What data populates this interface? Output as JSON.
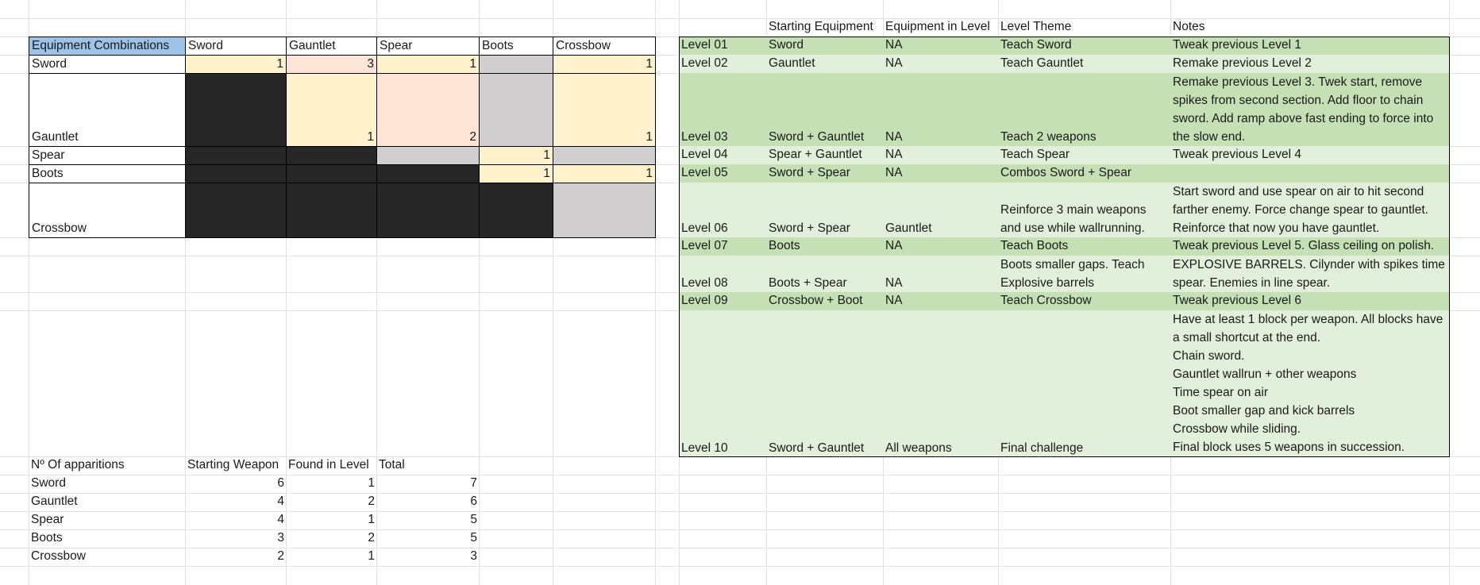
{
  "matrix": {
    "corner": "Equipment Combinations",
    "cols": [
      "Sword",
      "Gauntlet",
      "Spear",
      "Boots",
      "Crossbow"
    ],
    "rows": [
      "Sword",
      "Gauntlet",
      "Spear",
      "Boots",
      "Crossbow"
    ],
    "values": {
      "sword": {
        "sword": "1",
        "gauntlet": "3",
        "spear": "1",
        "crossbow": "1"
      },
      "gauntlet": {
        "gauntlet": "1",
        "spear": "2",
        "crossbow": "1"
      },
      "spear": {
        "boots": "1"
      },
      "boots": {
        "boots": "1",
        "crossbow": "1"
      }
    }
  },
  "levels": {
    "headers": {
      "starting": "Starting Equipment",
      "in_level": "Equipment in Level",
      "theme": "Level Theme",
      "notes": "Notes"
    },
    "rows": [
      {
        "level": "Level 01",
        "starting": "Sword",
        "in_level": "NA",
        "theme": "Teach Sword",
        "notes": "Tweak previous Level 1"
      },
      {
        "level": "Level 02",
        "starting": "Gauntlet",
        "in_level": "NA",
        "theme": "Teach Gauntlet",
        "notes": "Remake previous Level 2"
      },
      {
        "level": "Level 03",
        "starting": "Sword + Gauntlet",
        "in_level": "NA",
        "theme": "Teach 2 weapons",
        "notes": "Remake previous Level 3. Twek start, remove spikes from second section. Add floor to chain sword. Add ramp above fast ending to force into the slow end."
      },
      {
        "level": "Level 04",
        "starting": "Spear + Gauntlet",
        "in_level": "NA",
        "theme": "Teach Spear",
        "notes": "Tweak previous Level 4"
      },
      {
        "level": "Level 05",
        "starting": "Sword + Spear",
        "in_level": "NA",
        "theme": "Combos Sword + Spear",
        "notes": ""
      },
      {
        "level": "Level 06",
        "starting": "Sword + Spear",
        "in_level": "Gauntlet",
        "theme": " Reinforce 3 main weapons and use while wallrunning.",
        "notes": "Start sword and use spear on air to hit second farther enemy. Force change spear to gauntlet. Reinforce that now you have gauntlet."
      },
      {
        "level": "Level 07",
        "starting": "Boots",
        "in_level": "NA",
        "theme": "Teach Boots",
        "notes": "Tweak previous Level 5. Glass ceiling on polish."
      },
      {
        "level": "Level 08",
        "starting": "Boots + Spear",
        "in_level": "NA",
        "theme": "Boots smaller gaps. Teach Explosive barrels",
        "notes": "EXPLOSIVE BARRELS. Cilynder with spikes time spear. Enemies in line spear."
      },
      {
        "level": "Level 09",
        "starting": "Crossbow + Boot",
        "in_level": "NA",
        "theme": "Teach Crossbow",
        "notes": "Tweak previous Level 6"
      },
      {
        "level": "Level 10",
        "starting": "Sword + Gauntlet",
        "in_level": "All weapons",
        "theme": "Final challenge",
        "notes": ""
      }
    ],
    "level10_notes": [
      "Have at least 1 block per weapon. All blocks have a small shortcut at the end.",
      "Chain sword.",
      "Gauntlet wallrun + other weapons",
      "Time spear on air",
      "Boot smaller gap and kick barrels",
      "Crossbow while sliding.",
      "Final block uses 5 weapons in succession."
    ]
  },
  "apparitions": {
    "headers": {
      "title": "Nº Of apparitions",
      "starting": "Starting Weapon",
      "found": "Found in Level",
      "total": "Total"
    },
    "rows": [
      {
        "name": "Sword",
        "starting": "6",
        "found": "1",
        "total": "7"
      },
      {
        "name": "Gauntlet",
        "starting": "4",
        "found": "2",
        "total": "6"
      },
      {
        "name": "Spear",
        "starting": "4",
        "found": "1",
        "total": "5"
      },
      {
        "name": "Boots",
        "starting": "3",
        "found": "2",
        "total": "5"
      },
      {
        "name": "Crossbow",
        "starting": "2",
        "found": "1",
        "total": "3"
      }
    ]
  },
  "colors": {
    "header_blue": "#9dc3e6",
    "cell_yellow": "#fff2cc",
    "cell_pink": "#fce4d6",
    "cell_gray": "#d0cece",
    "cell_black": "#262626",
    "level_green_dark": "#c5e0b4",
    "level_green_light": "#e2efda"
  }
}
